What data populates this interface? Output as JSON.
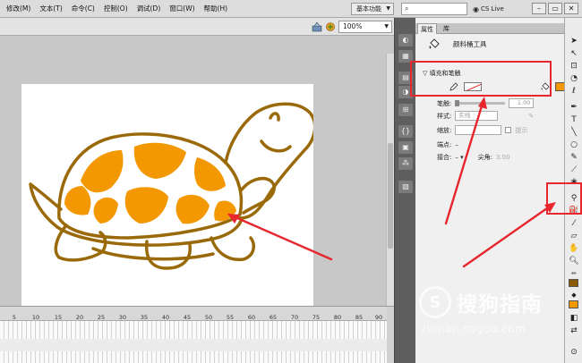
{
  "menubar": {
    "items": [
      "修改(M)",
      "文本(T)",
      "命令(C)",
      "控制(O)",
      "调试(D)",
      "窗口(W)",
      "帮助(H)"
    ],
    "workspace": "基本功能",
    "cs_live": "CS Live",
    "win_buttons": [
      "–",
      "▭",
      "✕"
    ]
  },
  "doc": {
    "zoom": "100%"
  },
  "timeline": {
    "ruler_labels": [
      "5",
      "10",
      "15",
      "20",
      "25",
      "30",
      "35",
      "40",
      "45",
      "50",
      "55",
      "60",
      "65",
      "70",
      "75",
      "80",
      "85",
      "90"
    ]
  },
  "properties": {
    "tab_properties": "属性",
    "tab_library": "库",
    "tool_title": "颜料桶工具",
    "section_fill_stroke": "填充和笔触",
    "stroke_label": "笔触:",
    "stroke_value": "1.00",
    "style_label": "样式:",
    "style_value": "实线",
    "scale_label": "缩放:",
    "hint_label": "提示",
    "cap_label": "端点:",
    "join_label": "接合:",
    "miter_label": "尖角:",
    "miter_value": "3.00"
  },
  "colors": {
    "fill": "#f39800",
    "turtle_stroke": "#9a6a0a",
    "stroke_tool": "#8b5a00",
    "annotation": "#e8262d"
  },
  "watermark": {
    "name": "搜狗指南",
    "url": "zhinan.sogou.com"
  }
}
